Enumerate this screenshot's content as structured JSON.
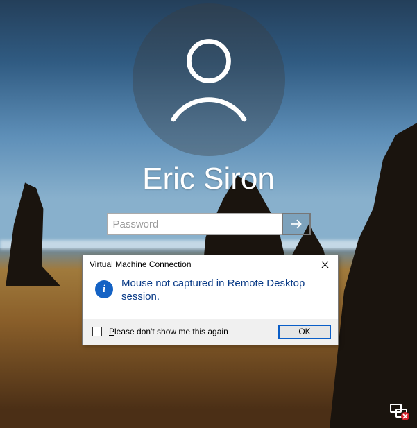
{
  "login": {
    "username": "Eric Siron",
    "password_placeholder": "Password",
    "password_value": ""
  },
  "dialog": {
    "title": "Virtual Machine Connection",
    "message": "Mouse not captured in Remote Desktop session.",
    "dont_show_label": "Please don't show me this again",
    "dont_show_underline_index": 0,
    "dont_show_checked": false,
    "ok_label": "OK"
  }
}
